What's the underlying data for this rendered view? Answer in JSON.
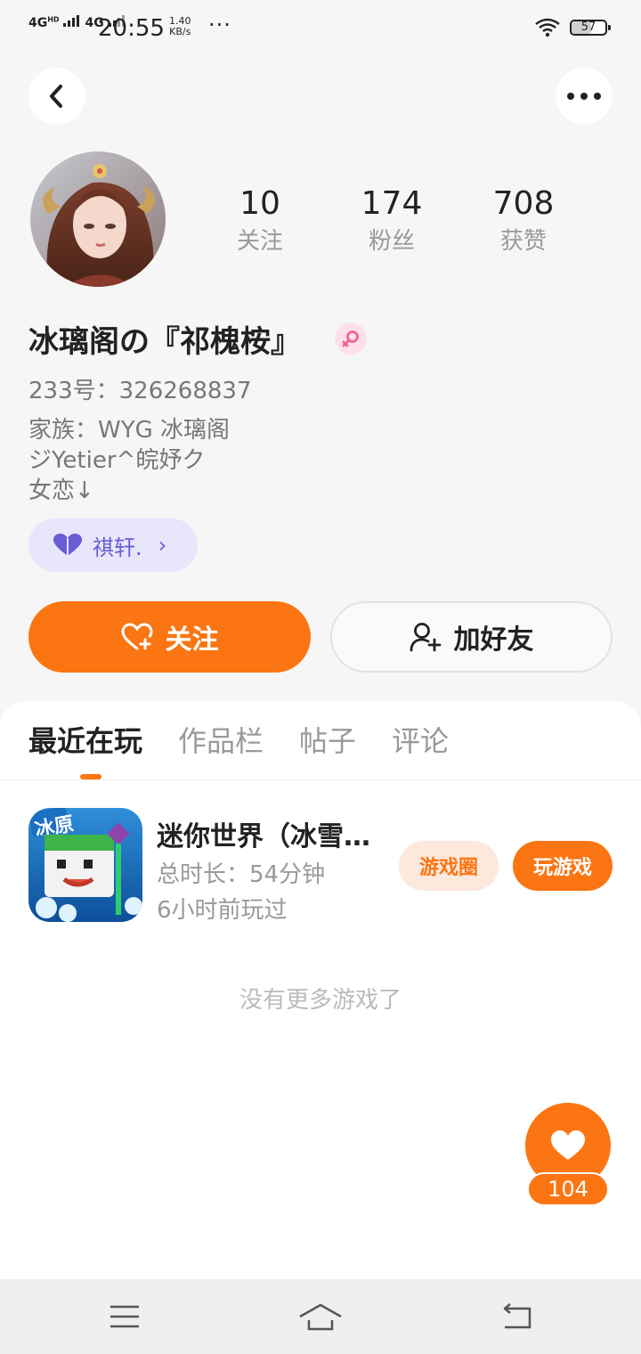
{
  "status_bar": {
    "network_1": "4G",
    "network_1_sup": "HD",
    "network_2": "4G",
    "time": "20:55",
    "speed_value": "1.40",
    "speed_unit": "KB/s",
    "dots": "···",
    "battery": "57",
    "battery_level": 0.57
  },
  "header": {
    "back_icon": "chevron-left-icon",
    "more_icon": "more-horizontal-icon"
  },
  "profile": {
    "stats": [
      {
        "value": "10",
        "label": "关注"
      },
      {
        "value": "174",
        "label": "粉丝"
      },
      {
        "value": "708",
        "label": "获赞"
      }
    ],
    "name": "冰璃阁の『祁槐桉』",
    "gender": "female",
    "uid": "233号：326268837",
    "bio_lines": [
      "家族：WYG 冰璃阁",
      "ジYetier^皖妤ク",
      "女恋↓"
    ],
    "family_chip": {
      "label": "祺轩.",
      "chevron": "›"
    }
  },
  "actions": {
    "follow_label": "关注",
    "add_friend_label": "加好友"
  },
  "tabs": [
    {
      "label": "最近在玩",
      "active": true
    },
    {
      "label": "作品栏",
      "active": false
    },
    {
      "label": "帖子",
      "active": false
    },
    {
      "label": "评论",
      "active": false
    }
  ],
  "games": [
    {
      "icon_text": "冰原",
      "title": "迷你世界（冰雪…",
      "duration": "总时长：54分钟",
      "last_played": "6小时前玩过",
      "circle_label": "游戏圈",
      "play_label": "玩游戏"
    }
  ],
  "empty_message": "没有更多游戏了",
  "like": {
    "count": "104"
  },
  "colors": {
    "accent": "#fb7512",
    "accent_light": "#fde8dc",
    "family_bg": "#e8e6fb",
    "family_text": "#6a5cd6",
    "gender_bg": "#fde0ea",
    "gender_icon": "#f06292"
  },
  "navbar": {
    "menu_icon": "menu-icon",
    "home_icon": "home-icon",
    "back_icon": "back-arrow-icon"
  }
}
